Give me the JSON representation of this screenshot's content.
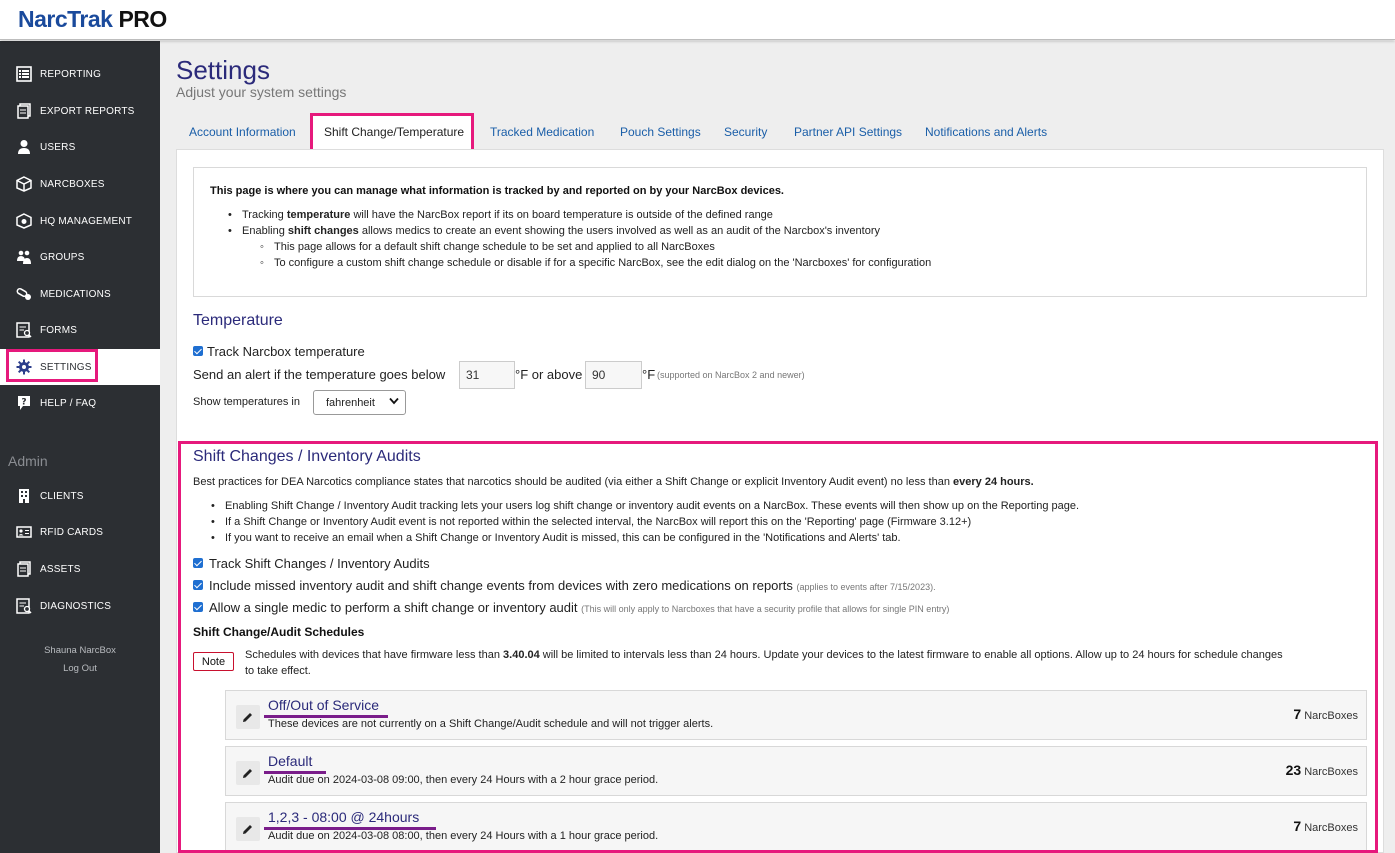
{
  "app": {
    "brand": "NarcTrak",
    "edition": "PRO"
  },
  "sidebar": {
    "items": [
      {
        "label": "REPORTING",
        "icon": "list-icon"
      },
      {
        "label": "EXPORT REPORTS",
        "icon": "documents-icon"
      },
      {
        "label": "USERS",
        "icon": "user-icon"
      },
      {
        "label": "NARCBOXES",
        "icon": "box-icon"
      },
      {
        "label": "HQ MANAGEMENT",
        "icon": "box-gear-icon"
      },
      {
        "label": "GROUPS",
        "icon": "group-icon"
      },
      {
        "label": "MEDICATIONS",
        "icon": "pills-icon"
      },
      {
        "label": "FORMS",
        "icon": "form-icon"
      },
      {
        "label": "SETTINGS",
        "icon": "gear-icon"
      },
      {
        "label": "HELP / FAQ",
        "icon": "question-icon"
      }
    ],
    "admin_heading": "Admin",
    "admin_items": [
      {
        "label": "CLIENTS",
        "icon": "building-icon"
      },
      {
        "label": "RFID CARDS",
        "icon": "id-card-icon"
      },
      {
        "label": "ASSETS",
        "icon": "documents-icon"
      },
      {
        "label": "DIAGNOSTICS",
        "icon": "form-icon"
      }
    ],
    "user_name": "Shauna NarcBox",
    "logout": "Log Out"
  },
  "page": {
    "title": "Settings",
    "subtitle": "Adjust your system settings"
  },
  "tabs": [
    "Account Information",
    "Shift Change/Temperature",
    "Tracked Medication",
    "Pouch Settings",
    "Security",
    "Partner API Settings",
    "Notifications and Alerts"
  ],
  "info": {
    "title": "This page is where you can manage what information is tracked by and reported on by your NarcBox devices.",
    "li1_pre": "Tracking ",
    "li1_bold": "temperature",
    "li1_post": " will have the NarcBox report if its on board temperature is outside of the defined range",
    "li2_pre": "Enabling ",
    "li2_bold": "shift changes",
    "li2_post": " allows medics to create an event showing the users involved as well as an audit of the Narcbox's inventory",
    "sub1": "This page allows for a default shift change schedule to be set and applied to all NarcBoxes",
    "sub2": "To configure a custom shift change schedule or disable if for a specific NarcBox, see the edit dialog on the 'Narcboxes' for configuration"
  },
  "temperature": {
    "heading": "Temperature",
    "track_label": "Track Narcbox temperature",
    "alert_pre": "Send an alert if the temperature goes below",
    "below": "31",
    "mid": "°F or above",
    "above": "90",
    "unit": "°F",
    "supported_note": "(supported on NarcBox 2 and newer)",
    "show_label": "Show temperatures in",
    "unit_select": "fahrenheit"
  },
  "shift": {
    "heading": "Shift Changes / Inventory Audits",
    "best_pre": "Best practices for DEA Narcotics compliance states that narcotics should be audited (via either a Shift Change or explicit Inventory Audit event) no less than ",
    "best_bold": "every 24 hours.",
    "b1": "Enabling Shift Change / Inventory Audit tracking lets your users log shift change or inventory audit events on a NarcBox. These events will then show up on the Reporting page.",
    "b2": "If a Shift Change or Inventory Audit event is not reported within the selected interval, the NarcBox will report this on the 'Reporting' page (Firmware 3.12+)",
    "b3": "If you want to receive an email when a Shift Change or Inventory Audit is missed, this can be configured in the 'Notifications and Alerts' tab.",
    "cb1": "Track Shift Changes / Inventory Audits",
    "cb2": "Include missed inventory audit and shift change events from devices with zero medications on reports",
    "cb2_note": "(applies to events after 7/15/2023).",
    "cb3": "Allow a single medic to perform a shift change or inventory audit",
    "cb3_note": "(This will only apply to Narcboxes that have a security profile that allows for single PIN entry)",
    "sched_heading": "Shift Change/Audit Schedules",
    "note_badge": "Note",
    "note_pre": "Schedules with devices that have firmware less than ",
    "note_bold": "3.40.04",
    "note_post": " will be limited to intervals less than 24 hours. Update your devices to the latest firmware to enable all options. Allow up to 24 hours for schedule changes",
    "note_line2": "to take effect.",
    "schedules": [
      {
        "name": "Off/Out of Service",
        "desc": "These devices are not currently on a Shift Change/Audit schedule and will not trigger alerts.",
        "count": "7",
        "unit": "NarcBoxes"
      },
      {
        "name": "Default",
        "desc": "Audit due on 2024-03-08 09:00, then every 24 Hours with a 2 hour grace period.",
        "count": "23",
        "unit": "NarcBoxes"
      },
      {
        "name": "1,2,3 - 08:00 @ 24hours",
        "desc": "Audit due on 2024-03-08 08:00, then every 24 Hours with a 1 hour grace period.",
        "count": "7",
        "unit": "NarcBoxes"
      }
    ]
  },
  "colors": {
    "highlight": "#e6197c",
    "sidebar": "#2c2f33",
    "heading": "#2b2a7a",
    "link": "#1a5ea8"
  }
}
